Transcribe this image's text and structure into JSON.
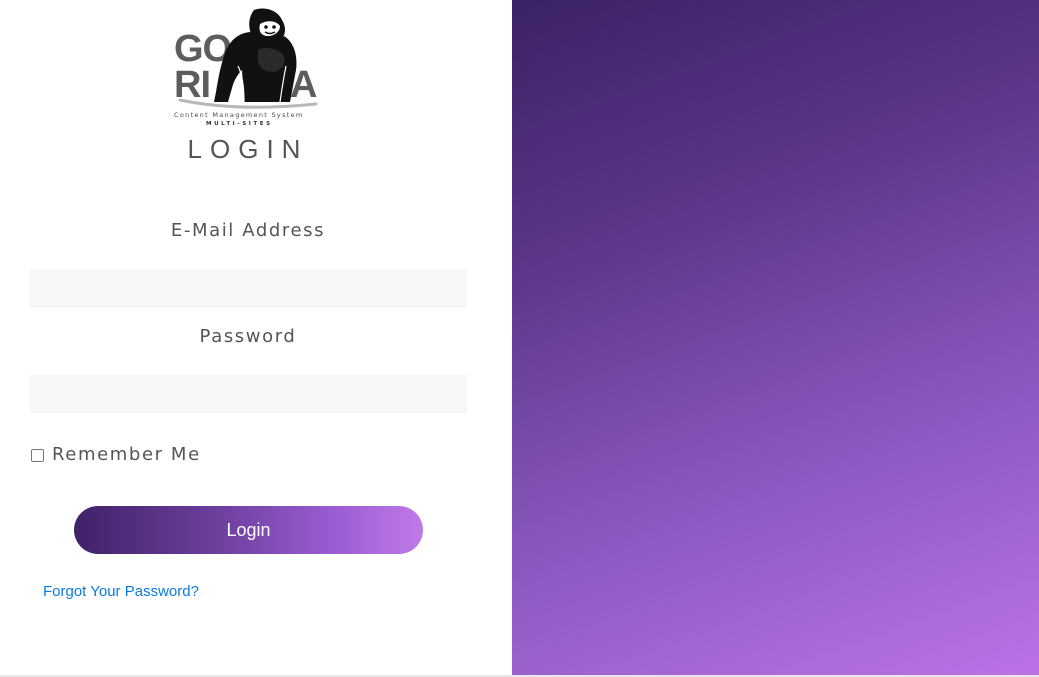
{
  "logo": {
    "word_top": "GO",
    "word_bottom_left": "RI",
    "word_bottom_right": "A",
    "tagline": "Content Management System",
    "subtagline": "MULTI-SITES",
    "text_color": "#5d5d5d",
    "icon": "gorilla-icon"
  },
  "form": {
    "title": "LOGIN",
    "email_label": "E-Mail Address",
    "email_value": "",
    "password_label": "Password",
    "password_value": "",
    "remember_label": "Remember Me",
    "remember_checked": false,
    "submit_label": "Login",
    "forgot_link": "Forgot Your Password?"
  },
  "colors": {
    "label_text": "#555555",
    "link": "#0b7be0",
    "gradient_start": "#3b2265",
    "gradient_end": "#bb72e6",
    "input_background": "#f8f8f8"
  }
}
